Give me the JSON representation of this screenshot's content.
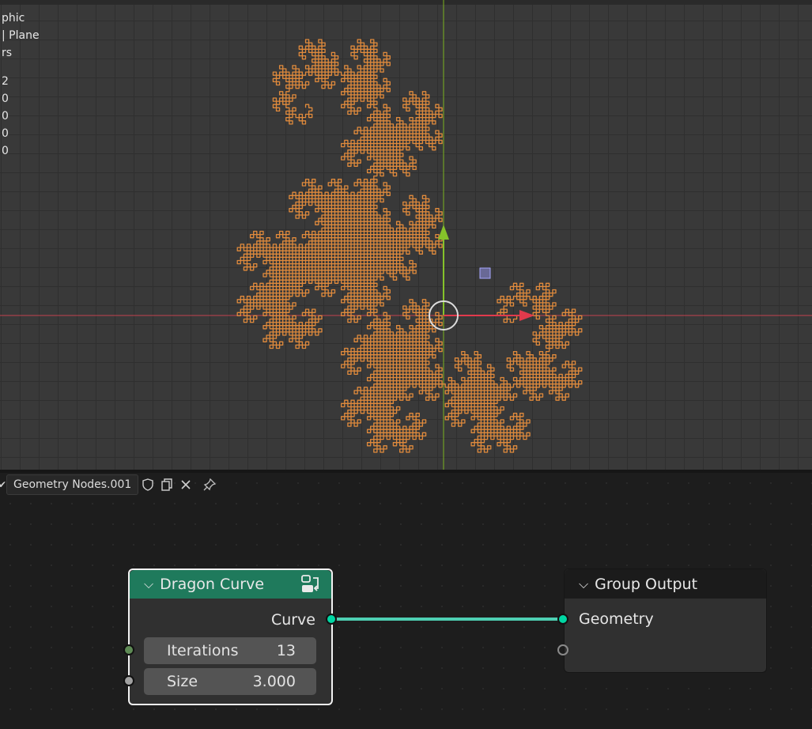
{
  "viewport": {
    "overlay_lines": [
      "phic",
      "| Plane",
      "rs"
    ],
    "overlay_stats": [
      "2",
      "0",
      "0",
      "0",
      "0"
    ]
  },
  "node_editor": {
    "node_group_name": "Geometry Nodes.001",
    "dragon_curve": {
      "title": "Dragon Curve",
      "output": "Curve",
      "iterations_label": "Iterations",
      "iterations_value": "13",
      "size_label": "Size",
      "size_value": "3.000"
    },
    "group_output": {
      "title": "Group Output",
      "input": "Geometry"
    }
  },
  "colors": {
    "fractal": "#e08a3c",
    "dragon_header": "#1f7a5c",
    "link": "#4ed0b3",
    "geometry_socket": "#00d6a3",
    "int_socket": "#5e8a55",
    "float_socket": "#a1a1a1",
    "axis_x": "#c4424e",
    "axis_y": "#7cb31e"
  },
  "icons": [
    "shield-icon",
    "copy-icon",
    "close-icon",
    "pin-icon",
    "node-group-icon",
    "chevron-down-icon"
  ]
}
